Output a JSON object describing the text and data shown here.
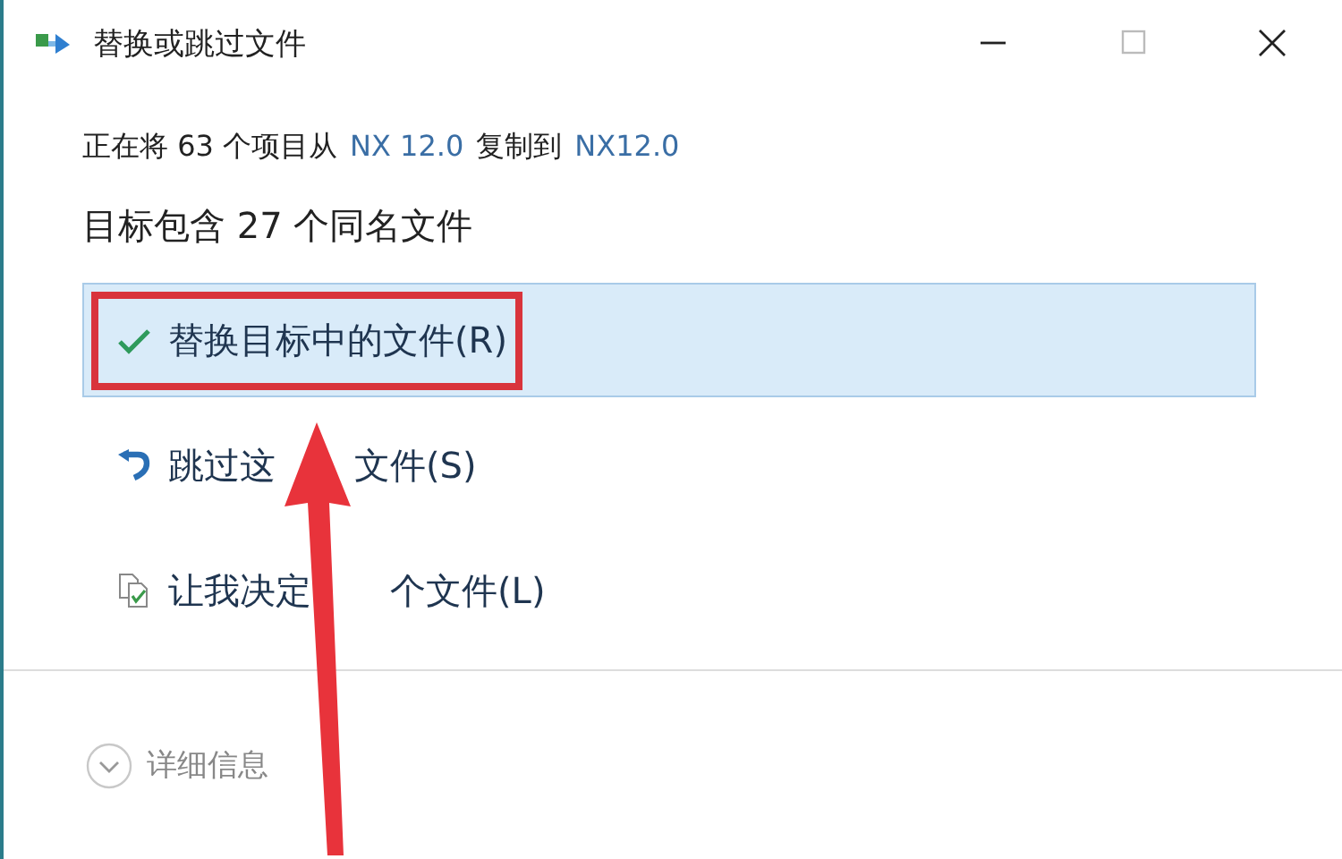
{
  "window": {
    "title": "替换或跳过文件",
    "controls": [
      {
        "kind": "minimize",
        "disabled": false
      },
      {
        "kind": "maximize",
        "disabled": true
      },
      {
        "kind": "close",
        "disabled": false
      }
    ]
  },
  "copy_status": [
    {
      "kind": "text",
      "text": "正在将 63 个项目从"
    },
    {
      "kind": "link",
      "text": "NX 12.0"
    },
    {
      "kind": "text",
      "text": "复制到"
    },
    {
      "kind": "link",
      "text": "NX12.0"
    }
  ],
  "heading": "目标包含 27 个同名文件",
  "options": [
    {
      "kind": "replace",
      "label_parts": [
        "替换目标中的文件(R)"
      ],
      "selected": true,
      "annotated": true
    },
    {
      "kind": "skip",
      "label_parts": [
        "跳过这",
        "文件(S)"
      ],
      "selected": false,
      "annotated": false
    },
    {
      "kind": "decide",
      "label_parts": [
        "让我决定",
        "个文件(L)"
      ],
      "selected": false,
      "annotated": false
    }
  ],
  "arrow": {
    "kind": "pointer"
  },
  "details": {
    "label": "详细信息",
    "expanded": false
  }
}
